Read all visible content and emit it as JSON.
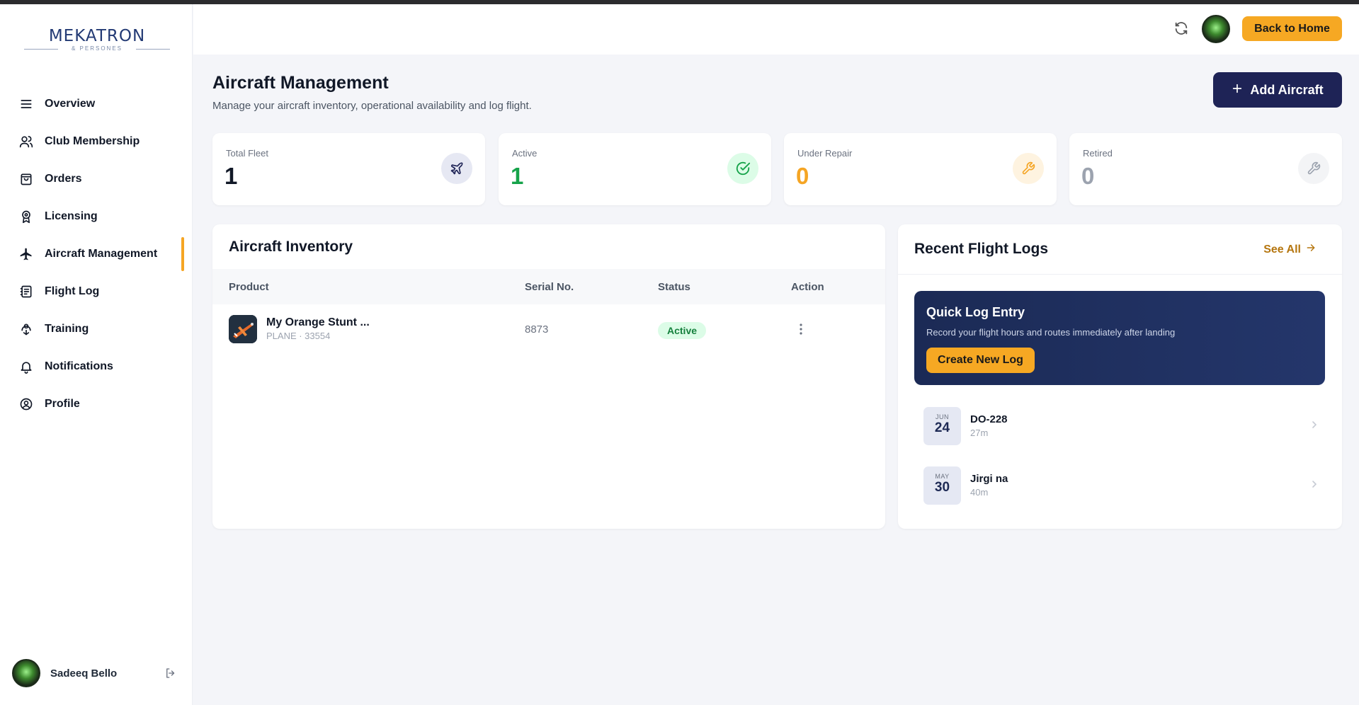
{
  "brand": {
    "logo_text": "MEKATRON",
    "logo_sub": "& PERSONES"
  },
  "sidebar": {
    "items": [
      {
        "label": "Overview",
        "icon": "menu-icon"
      },
      {
        "label": "Club Membership",
        "icon": "users-icon"
      },
      {
        "label": "Orders",
        "icon": "shopping-bag-icon"
      },
      {
        "label": "Licensing",
        "icon": "award-icon"
      },
      {
        "label": "Aircraft Management",
        "icon": "plane-icon",
        "active": true
      },
      {
        "label": "Flight Log",
        "icon": "notebook-icon"
      },
      {
        "label": "Training",
        "icon": "graduation-icon"
      },
      {
        "label": "Notifications",
        "icon": "bell-icon"
      },
      {
        "label": "Profile",
        "icon": "user-circle-icon"
      }
    ],
    "user": {
      "name": "Sadeeq Bello"
    }
  },
  "header": {
    "back_label": "Back to Home"
  },
  "page": {
    "title": "Aircraft Management",
    "subtitle": "Manage your aircraft inventory, operational availability and log flight.",
    "add_label": "Add Aircraft"
  },
  "stats": [
    {
      "label": "Total Fleet",
      "value": "1",
      "color": "#111827"
    },
    {
      "label": "Active",
      "value": "1",
      "color": "#16a34a"
    },
    {
      "label": "Under Repair",
      "value": "0",
      "color": "#f5a524"
    },
    {
      "label": "Retired",
      "value": "0",
      "color": "#9ca3af"
    }
  ],
  "inventory": {
    "title": "Aircraft Inventory",
    "columns": [
      "Product",
      "Serial No.",
      "Status",
      "Action"
    ],
    "rows": [
      {
        "name": "My Orange Stunt ...",
        "meta": "PLANE · 33554",
        "serial": "8873",
        "status": "Active"
      }
    ]
  },
  "logs": {
    "title": "Recent Flight Logs",
    "see_all": "See All",
    "quick": {
      "title": "Quick Log Entry",
      "subtitle": "Record your flight hours and routes immediately after landing",
      "button": "Create New Log"
    },
    "items": [
      {
        "month": "JUN",
        "day": "24",
        "name": "DO-228",
        "duration": "27m"
      },
      {
        "month": "MAY",
        "day": "30",
        "name": "Jirgi na",
        "duration": "40m"
      }
    ]
  }
}
